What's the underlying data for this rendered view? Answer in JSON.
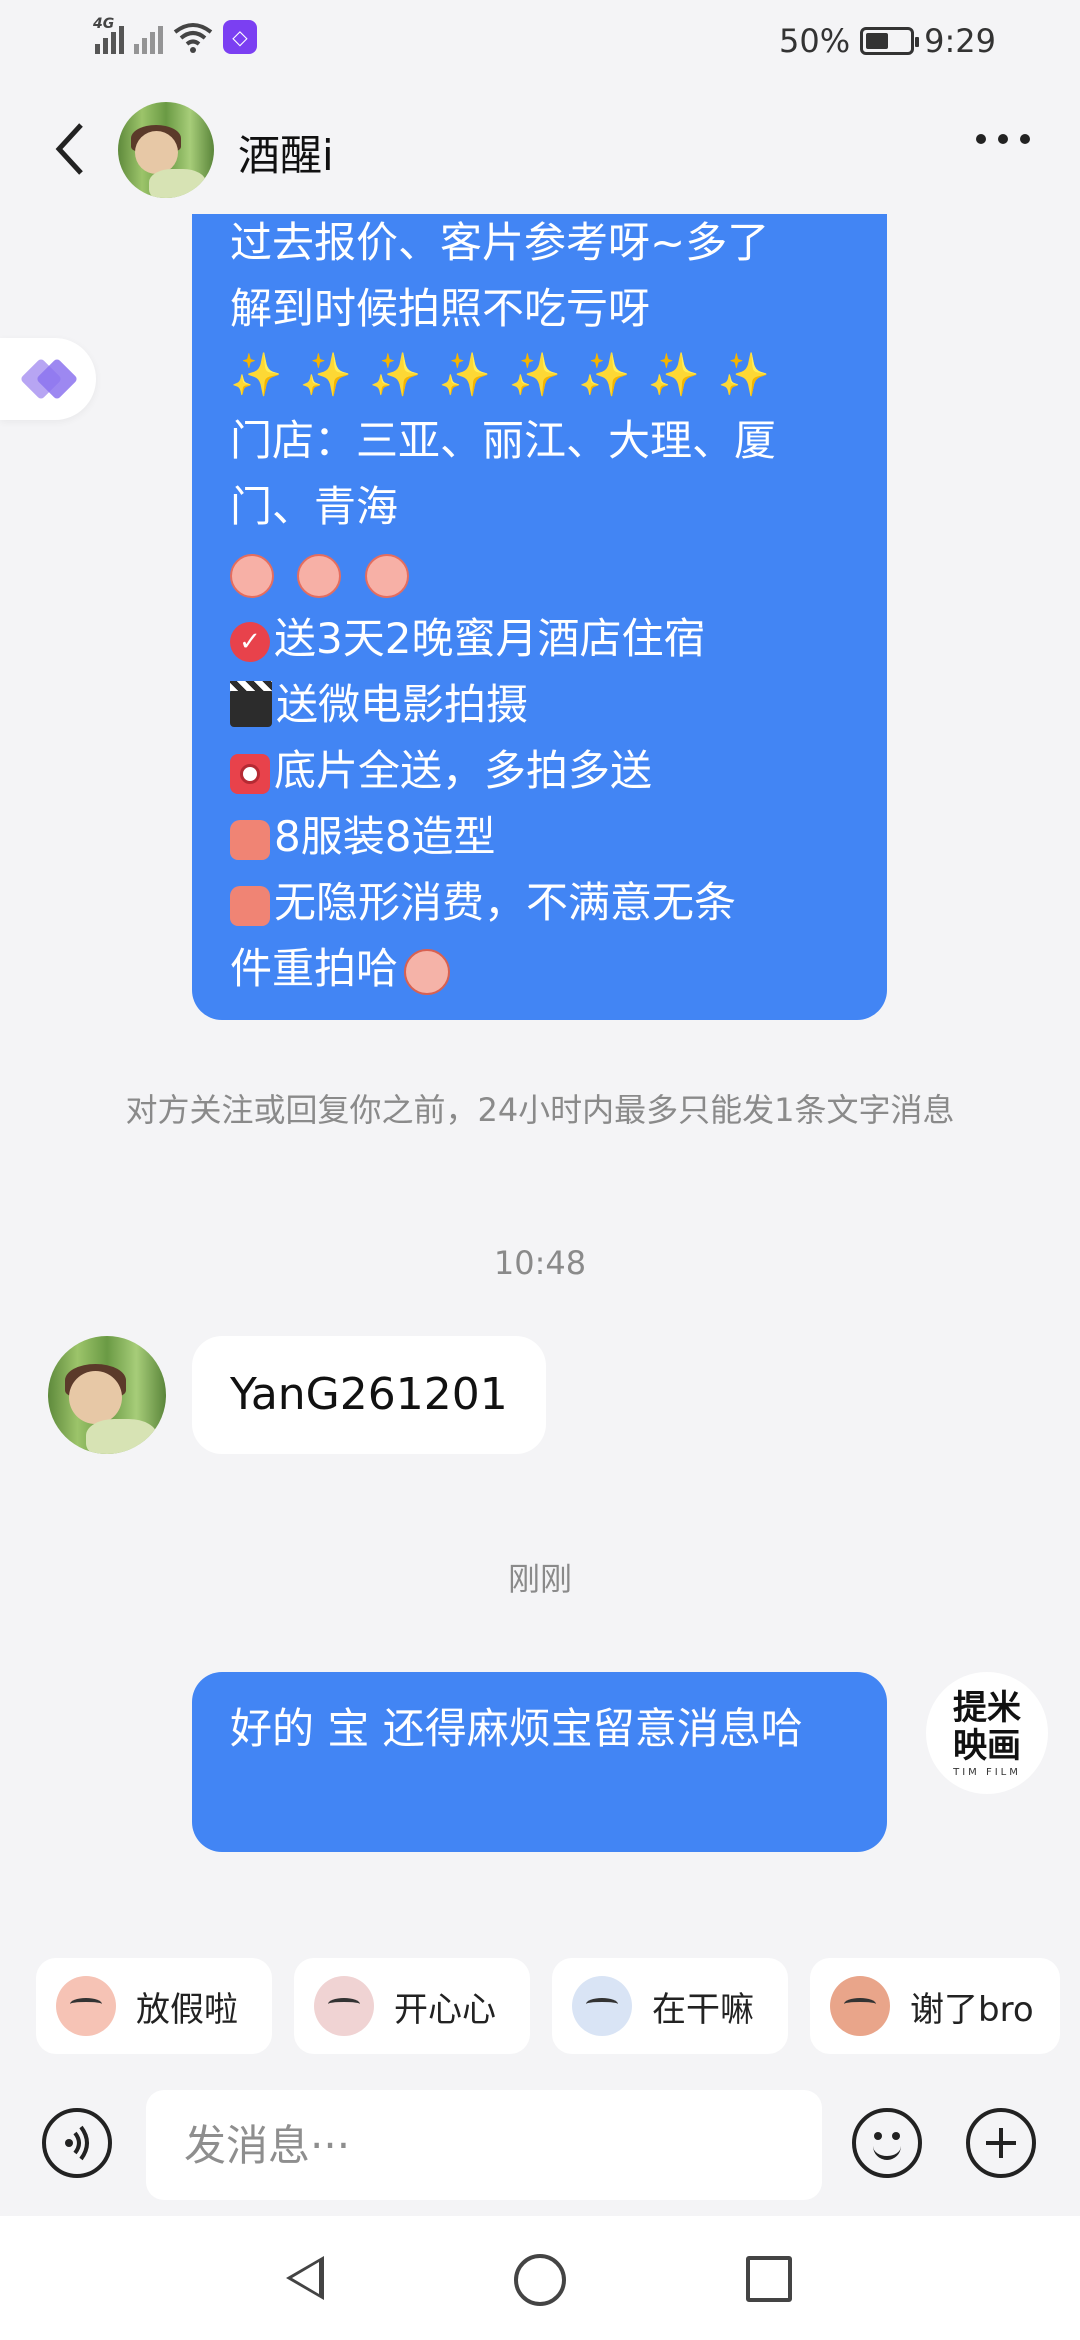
{
  "status_bar": {
    "network": "4G",
    "battery": "50%",
    "battery_level": 0.5,
    "time": "9:29"
  },
  "header": {
    "name": "酒醒i",
    "back_icon": "chevron-left-icon",
    "more_icon": "more-dots-icon"
  },
  "messages": {
    "big_bubble_lines": [
      "过去报价、客片参考呀~多了",
      "解到时候拍照不吃亏呀",
      "✨ ✨ ✨ ✨ ✨ ✨ ✨ ✨",
      "门店：三亚、丽江、大理、厦",
      "门、青海",
      "",
      "送3天2晚蜜月酒店住宿",
      "送微电影拍摄",
      "底片全送，多拍多送",
      "8服装8造型",
      "无隐形消费，不满意无条",
      "件重拍哈"
    ],
    "system_tip": "对方关注或回复你之前，24小时内最多只能发1条文字消息",
    "time_1": "10:48",
    "incoming_text": "YanG261201",
    "time_2": "刚刚",
    "outgoing_text": "好的 宝 还得麻烦宝留意消息哈"
  },
  "brand_avatar": {
    "line1": "提米",
    "line2": "映画",
    "sub": "TIM FILM"
  },
  "quick_replies": [
    "放假啦",
    "开心心",
    "在干嘛",
    "谢了bro"
  ],
  "input": {
    "placeholder": "发消息···"
  },
  "colors": {
    "bubble_out": "#4285f4",
    "bubble_in": "#ffffff",
    "background": "#f4f4f6",
    "sparkle": "#ffe24a"
  }
}
